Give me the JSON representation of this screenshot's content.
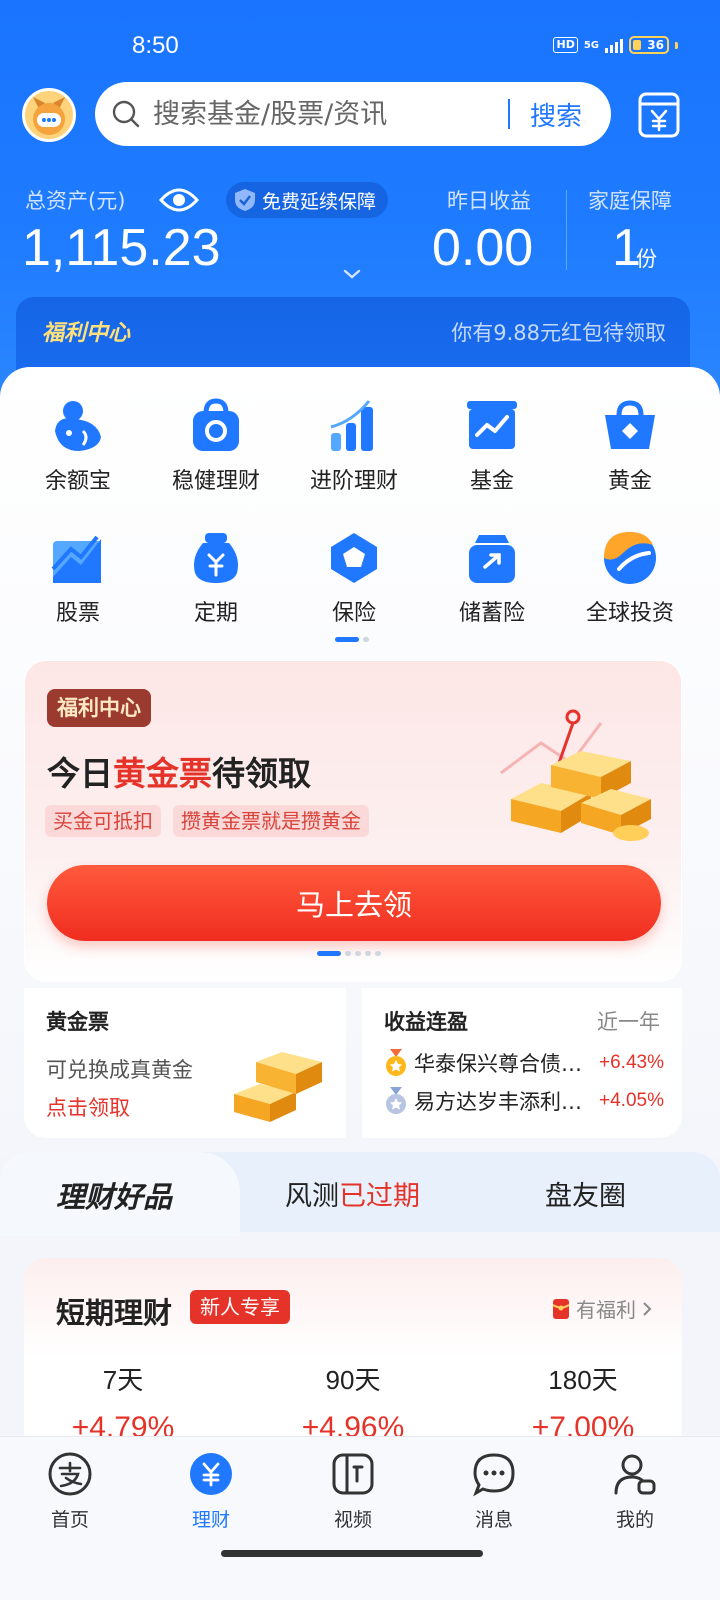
{
  "status_bar": {
    "time": "8:50",
    "network_badge": "HD",
    "network_type": "5G",
    "battery_level": "36"
  },
  "header": {
    "search_placeholder": "搜索基金/股票/资讯",
    "search_button": "搜索",
    "total_assets_label": "总资产(元)",
    "total_assets_value": "1,115.23",
    "protection_badge": "免费延续保障",
    "yesterday_income_label": "昨日收益",
    "yesterday_income_value": "0.00",
    "family_protection_label": "家庭保障",
    "family_protection_value": "1",
    "family_protection_unit": "份"
  },
  "welfare_bar": {
    "title": "福利中心",
    "tip": "你有9.88元红包待领取"
  },
  "grid": [
    {
      "label": "余额宝",
      "icon": "yuebao-icon"
    },
    {
      "label": "稳健理财",
      "icon": "steady-finance-icon"
    },
    {
      "label": "进阶理财",
      "icon": "advanced-finance-icon"
    },
    {
      "label": "基金",
      "icon": "fund-icon"
    },
    {
      "label": "黄金",
      "icon": "gold-icon"
    },
    {
      "label": "股票",
      "icon": "stock-icon"
    },
    {
      "label": "定期",
      "icon": "fixed-term-icon"
    },
    {
      "label": "保险",
      "icon": "insurance-icon"
    },
    {
      "label": "储蓄险",
      "icon": "savings-insurance-icon"
    },
    {
      "label": "全球投资",
      "icon": "global-invest-icon"
    }
  ],
  "promo": {
    "tag": "福利中心",
    "title_prefix": "今日",
    "title_highlight": "黄金票",
    "title_suffix": "待领取",
    "chips": [
      "买金可抵扣",
      "攒黄金票就是攒黄金"
    ],
    "button": "马上去领"
  },
  "gold_ticket": {
    "title": "黄金票",
    "desc": "可兑换成真黄金",
    "link": "点击领取"
  },
  "profit_streak": {
    "title": "收益连盈",
    "period": "近一年",
    "funds": [
      {
        "name": "华泰保兴尊合债券A",
        "rate": "+6.43%",
        "medal": "gold"
      },
      {
        "name": "易方达岁丰添利债券",
        "rate": "+4.05%",
        "medal": "silver"
      }
    ]
  },
  "tabs": {
    "tab1": "理财好品",
    "tab2_prefix": "风测",
    "tab2_status": "已过期",
    "tab3": "盘友圈"
  },
  "short_term": {
    "title": "短期理财",
    "badge": "新人专享",
    "benefit": "有福利",
    "terms": [
      {
        "days": "7天",
        "rate": "+4.79%"
      },
      {
        "days": "90天",
        "rate": "+4.96%"
      },
      {
        "days": "180天",
        "rate": "+7.00%"
      }
    ]
  },
  "bottom_nav": [
    {
      "label": "首页",
      "icon": "alipay-home-icon"
    },
    {
      "label": "理财",
      "icon": "wealth-icon",
      "active": true
    },
    {
      "label": "视频",
      "icon": "video-icon"
    },
    {
      "label": "消息",
      "icon": "message-icon"
    },
    {
      "label": "我的",
      "icon": "profile-icon"
    }
  ],
  "colors": {
    "brand_blue": "#1f78ff",
    "accent_red": "#e5332a",
    "gold": "#ffc53d"
  }
}
